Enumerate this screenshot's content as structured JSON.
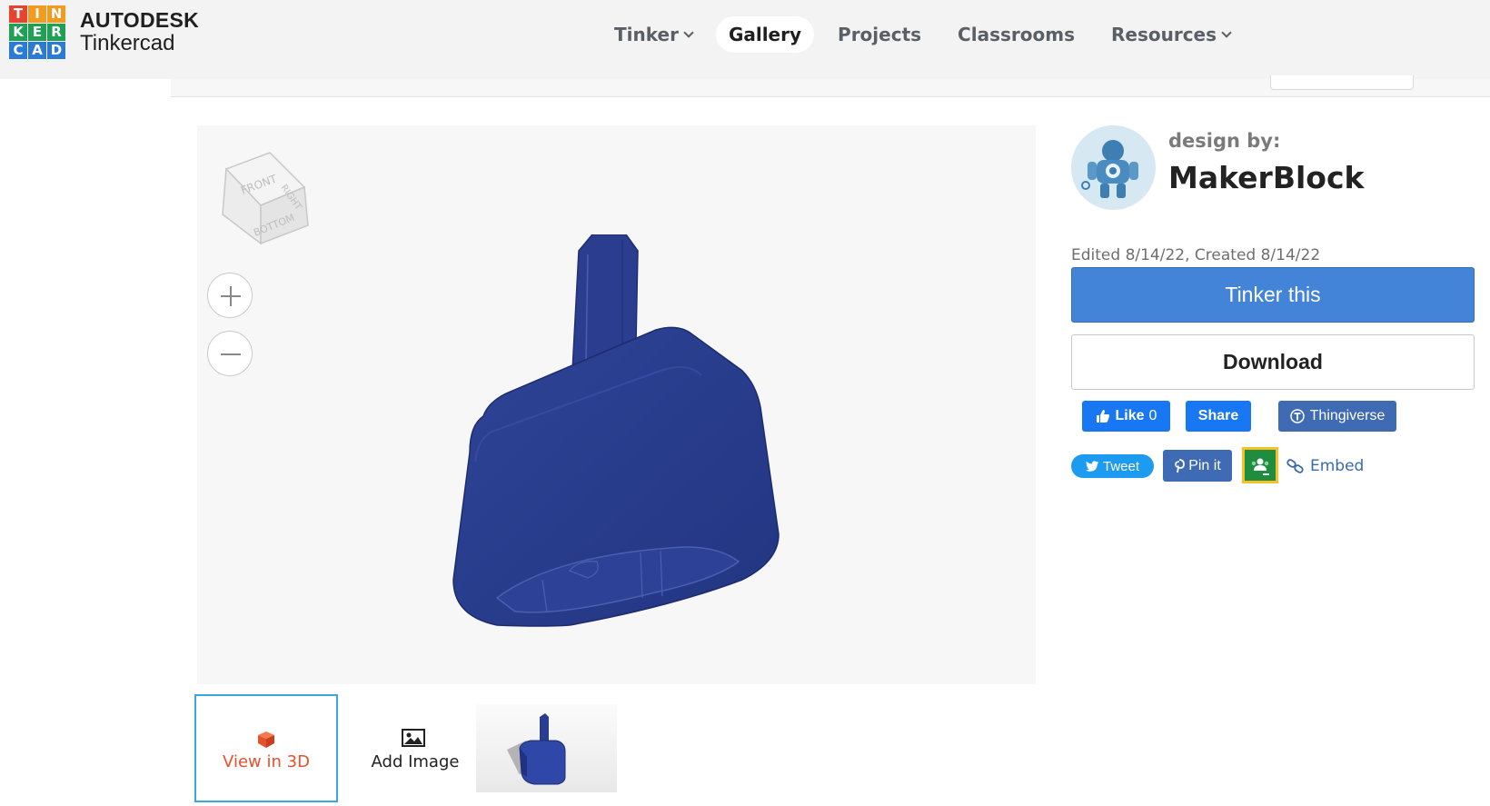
{
  "brand": {
    "logo_letters": [
      "T",
      "I",
      "N",
      "K",
      "E",
      "R",
      "C",
      "A",
      "D"
    ],
    "logo_colors": [
      "#e8432e",
      "#f39b1f",
      "#f39b1f",
      "#1fa055",
      "#1fa055",
      "#1fa055",
      "#2b7bd4",
      "#2b7bd4",
      "#2b7bd4"
    ],
    "company": "AUTODESK",
    "product": "Tinkercad"
  },
  "nav": {
    "items": [
      {
        "label": "Tinker",
        "dropdown": true
      },
      {
        "label": "Gallery",
        "active": true
      },
      {
        "label": "Projects"
      },
      {
        "label": "Classrooms"
      },
      {
        "label": "Resources",
        "dropdown": true
      }
    ]
  },
  "viewer": {
    "view_cube_faces": [
      "FRONT",
      "RIGHT",
      "BOTTOM"
    ],
    "zoom_in_icon": "plus-icon",
    "zoom_out_icon": "minus-icon",
    "model_color": "#2b3f8f"
  },
  "thumbnails": {
    "view3d_label": "View in 3D",
    "add_image_label": "Add Image"
  },
  "design": {
    "design_by_label": "design by:",
    "author": "MakerBlock",
    "dates": "Edited 8/14/22, Created 8/14/22"
  },
  "actions": {
    "tinker_label": "Tinker this",
    "download_label": "Download"
  },
  "social": {
    "like_label": "Like",
    "like_count": "0",
    "share_label": "Share",
    "thingiverse_label": "Thingiverse",
    "tweet_label": "Tweet",
    "pin_label": "Pin it",
    "embed_label": "Embed"
  },
  "colors": {
    "accent_blue": "#4383d8",
    "view3d_orange": "#e4512c",
    "selected_border": "#3fa5de"
  }
}
